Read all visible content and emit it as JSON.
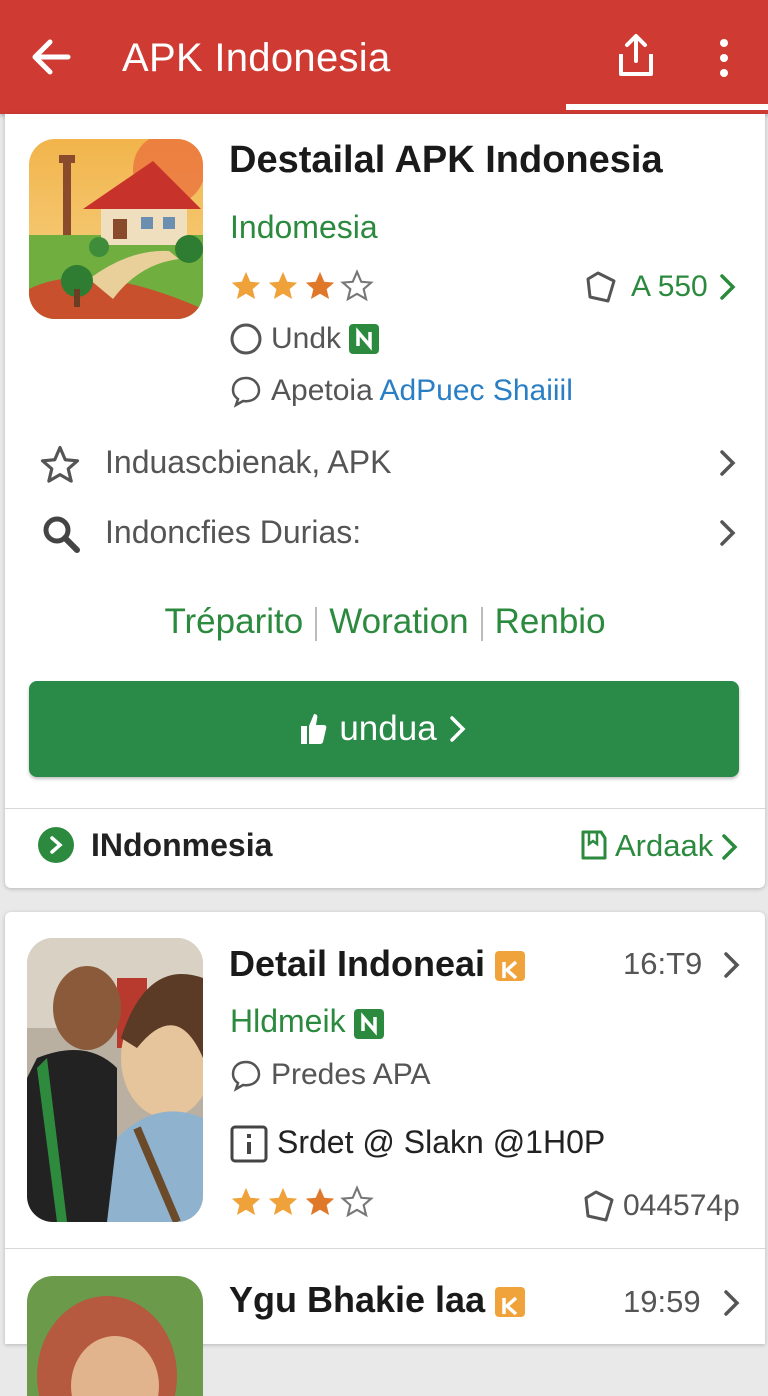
{
  "appbar": {
    "title": "APK Indonesia",
    "back_icon": "arrow-back-icon",
    "share_icon": "share-icon",
    "more_icon": "more-vert-icon",
    "color": "#cf3b33"
  },
  "detail": {
    "title": "Destailal APK Indonesia",
    "developer": "Indomesia",
    "rating_stars": 3,
    "size_label": "A 550",
    "status_label": "Undk",
    "author_prefix": "Apetoia",
    "author_link": "AdPuec Shaiiil",
    "row1_label": "Induascbienak, APK",
    "row2_label": "Indoncfies Durias:",
    "tabs": [
      "Tréparito",
      "Woration",
      "Renbio"
    ],
    "download_label": "undua",
    "footer_left": "INdonmesia",
    "footer_right": "Ardaak",
    "accent_green": "#2b8a3e"
  },
  "list": [
    {
      "title": "Detail Indoneai",
      "time": "16:T9",
      "subtitle": "Hldmeik",
      "meta": "Predes APA",
      "info": "Srdet @ Slakn @1H0P",
      "rating_stars": 3,
      "count": "044574p"
    },
    {
      "title": "Ygu Bhakie laa",
      "time": "19:59"
    }
  ]
}
